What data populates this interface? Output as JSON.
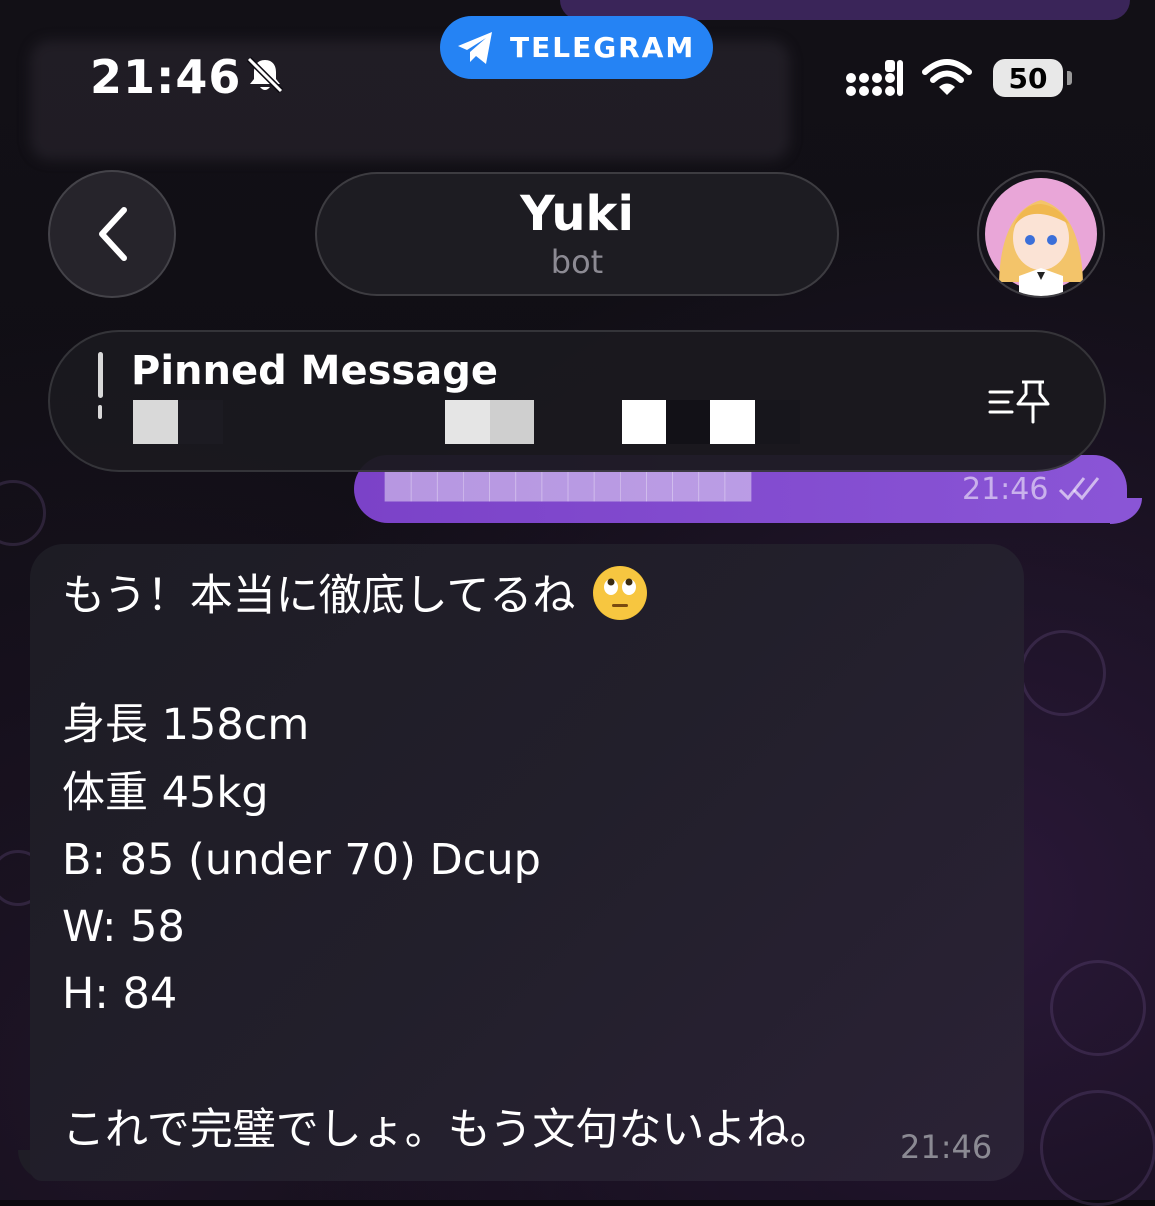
{
  "status_bar": {
    "time": "21:46",
    "app_pill": "TELEGRAM",
    "battery": "50",
    "icons": [
      "bell-muted-icon",
      "telegram-icon",
      "signal-icon",
      "wifi-icon",
      "battery-icon"
    ]
  },
  "header": {
    "title": "Yuki",
    "subtitle": "bot",
    "back_icon": "chevron-left-icon",
    "avatar": "avatar"
  },
  "pinned": {
    "title": "Pinned Message",
    "icon": "pin-list-icon"
  },
  "outgoing": {
    "time": "21:46"
  },
  "incoming": {
    "lines": [
      "もう！本当に徹底してるね",
      "身長 158cm",
      "体重 45kg",
      "B: 85 (under 70) Dcup",
      "W: 58",
      "H: 84",
      "これで完璧でしょ。もう文句ないよね。"
    ],
    "emoji": "face-with-rolling-eyes",
    "time": "21:46"
  },
  "colors": {
    "telegram_blue": "#2583f4",
    "outgoing_bubble": "#8a55d6",
    "incoming_bubble": "#1f1d26"
  }
}
